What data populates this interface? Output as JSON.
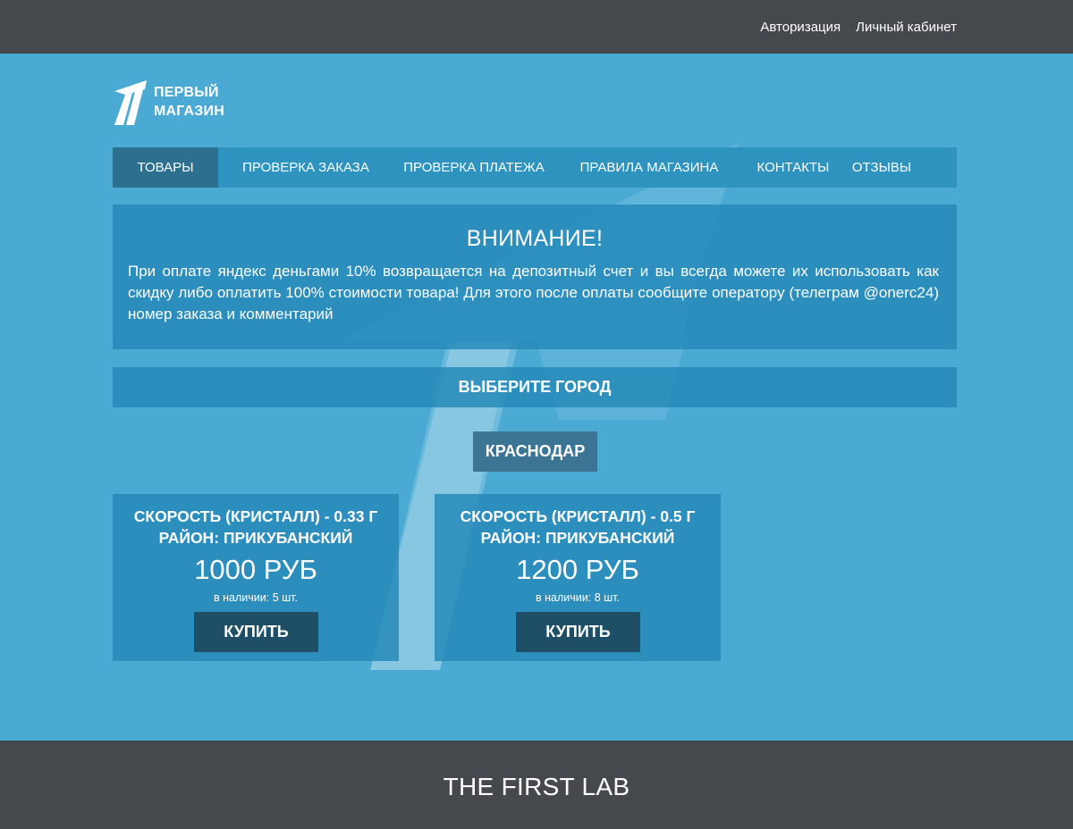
{
  "header": {
    "links": [
      "Авторизация",
      "Личный кабинет"
    ]
  },
  "logo": {
    "line1": "ПЕРВЫЙ",
    "line2": "МАГАЗИН"
  },
  "nav": {
    "items": [
      "ТОВАРЫ",
      "ПРОВЕРКА ЗАКАЗА",
      "ПРОВЕРКА ПЛАТЕЖА",
      "ПРАВИЛА МАГАЗИНА",
      "КОНТАКТЫ",
      "ОТЗЫВЫ"
    ],
    "active": "ТОВАРЫ"
  },
  "notice": {
    "title": "ВНИМАНИЕ!",
    "body": "При оплате яндекс деньгами 10% возвращается на депозитный счет и вы всегда можете их использовать как скидку либо оплатить 100% стоимости товара! Для этого после оплаты сообщите оператору (телеграм @onerc24) номер заказа и комментарий"
  },
  "city": {
    "heading": "ВЫБЕРИТЕ ГОРОД",
    "selected": "КРАСНОДАР"
  },
  "products": [
    {
      "name": "СКОРОСТЬ (КРИСТАЛЛ) - 0.33 Г",
      "district": "РАЙОН: ПРИКУБАНСКИЙ",
      "price": "1000 РУБ",
      "stock": "в наличии: 5 шт.",
      "buy_label": "КУПИТЬ"
    },
    {
      "name": "СКОРОСТЬ (КРИСТАЛЛ) - 0.5 Г",
      "district": "РАЙОН: ПРИКУБАНСКИЙ",
      "price": "1200 РУБ",
      "stock": "в наличии: 8 шт.",
      "buy_label": "КУПИТЬ"
    }
  ],
  "footer": {
    "brand": "THE FIRST LAB"
  },
  "colors": {
    "background": "#4aaad4",
    "panel": "#2f93c0",
    "dark_bar": "#45494d",
    "button": "#1f4f66",
    "active_nav": "#2d6f8e"
  }
}
